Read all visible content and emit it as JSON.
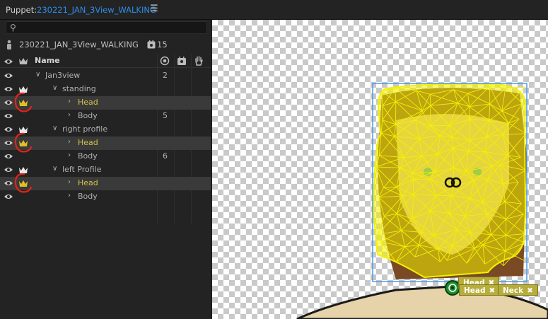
{
  "topbar": {
    "panel_label": "Puppet:",
    "puppet_name": "230221_JAN_3View_WALKING",
    "menu_icon": "hamburger-icon"
  },
  "search": {
    "placeholder": "",
    "icon": "search-icon"
  },
  "puppet": {
    "title": "230221_JAN_3View_WALKING",
    "count": "15"
  },
  "header": {
    "name": "Name"
  },
  "rows": [
    {
      "label": "Jan3view",
      "value": "2"
    },
    {
      "label": "standing",
      "value": ""
    },
    {
      "label": "Head",
      "value": ""
    },
    {
      "label": "Body",
      "value": "5"
    },
    {
      "label": "right profile",
      "value": ""
    },
    {
      "label": "Head",
      "value": ""
    },
    {
      "label": "Body",
      "value": "6"
    },
    {
      "label": "left Profile",
      "value": ""
    },
    {
      "label": "Head",
      "value": ""
    },
    {
      "label": "Body",
      "value": ""
    }
  ],
  "canvas": {
    "handle_tags": [
      {
        "label": "Head"
      },
      {
        "label": "Head"
      },
      {
        "label": "Neck"
      }
    ],
    "mesh_color": "#f4f000",
    "bounds_color": "#4a9be8"
  },
  "colors": {
    "accent": "#2d8ceb",
    "highlight": "#d2c14a",
    "annotation": "#e2231a"
  }
}
